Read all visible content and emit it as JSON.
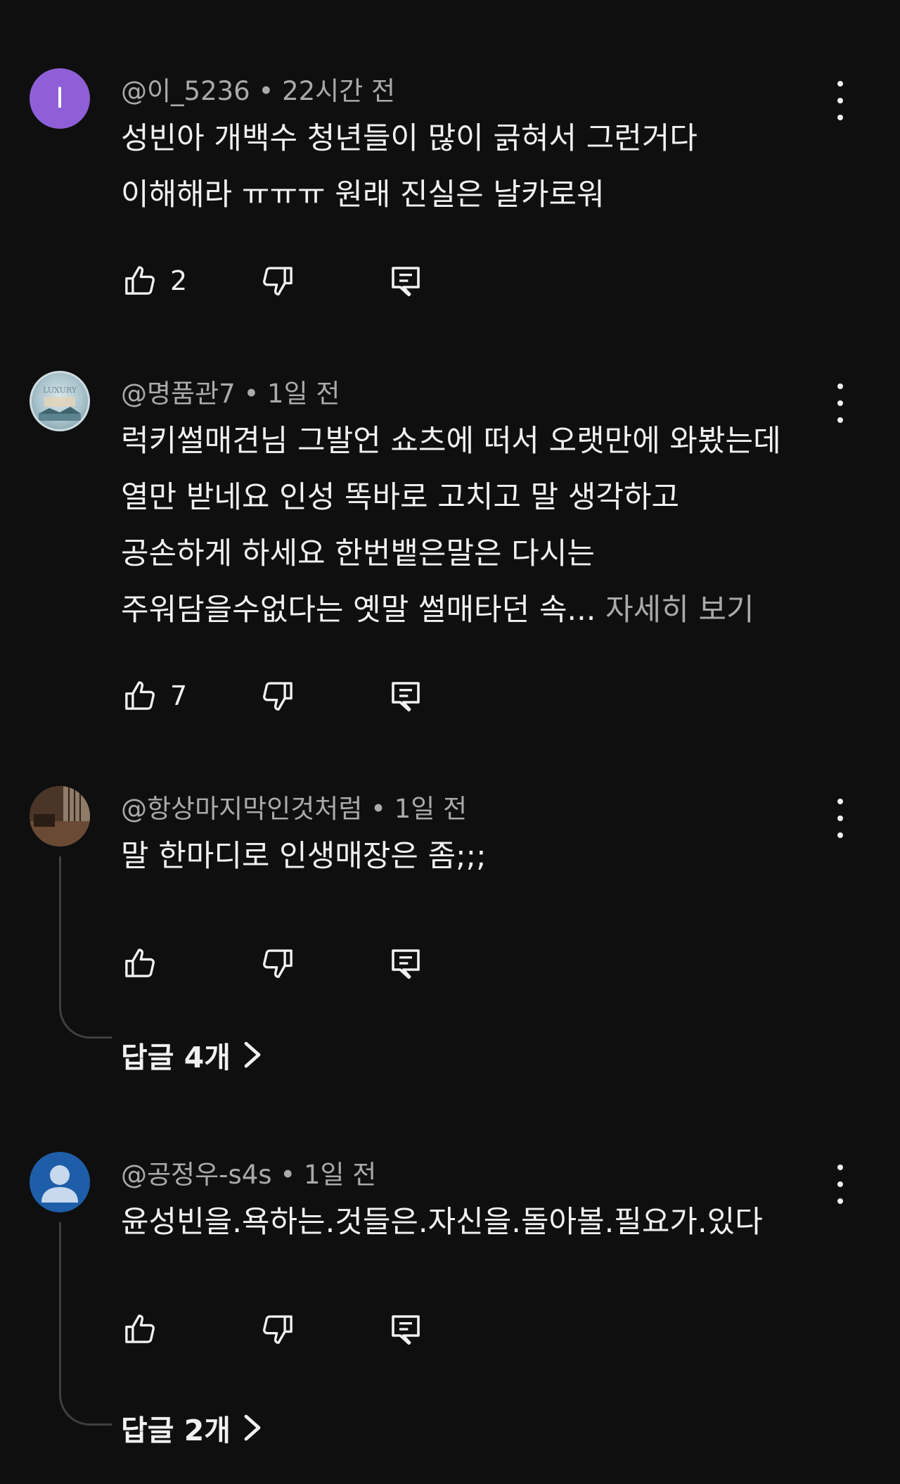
{
  "comments": [
    {
      "author": "@이_5236",
      "separator": "•",
      "time": "22시간 전",
      "avatar_letter": "I",
      "avatar_color": "#8e5fd6",
      "text_lines": [
        "성빈아 개백수 청년들이 많이 긁혀서 그런거다",
        "이해해라 ㅠㅠㅠ 원래 진실은 날카로워"
      ],
      "likes": "2"
    },
    {
      "author": "@명품관7",
      "separator": "•",
      "time": "1일 전",
      "avatar_text": "LUXURY",
      "text_lines": [
        "럭키썰매견님 그발언 쇼츠에 떠서 오랫만에 와봤는데",
        "열만 받네요 인성 똑바로 고치고 말 생각하고",
        "공손하게 하세요 한번뱉은말은 다시는",
        "주워담을수없다는 옛말 썰매타던 속..."
      ],
      "read_more": "자세히 보기",
      "likes": "7"
    },
    {
      "author": "@항상마지막인것처럼",
      "separator": "•",
      "time": "1일 전",
      "text_lines": [
        "말 한마디로 인생매장은 좀;;;"
      ],
      "likes": "",
      "replies": "답글 4개"
    },
    {
      "author": "@공정우-s4s",
      "separator": "•",
      "time": "1일 전",
      "avatar_color": "#1e5ea8",
      "text_lines": [
        "윤성빈을.욕하는.것들은.자신을.돌아볼.필요가.있다"
      ],
      "likes": "",
      "replies": "답글 2개"
    }
  ],
  "icons": {
    "like": "thumbs-up-icon",
    "dislike": "thumbs-down-icon",
    "reply": "comment-reply-icon",
    "more": "more-vert-icon",
    "chevron": "chevron-right-icon"
  },
  "colors": {
    "background": "#0f0f0f",
    "text": "#f1f1f1",
    "secondary_text": "#aaaaaa"
  }
}
